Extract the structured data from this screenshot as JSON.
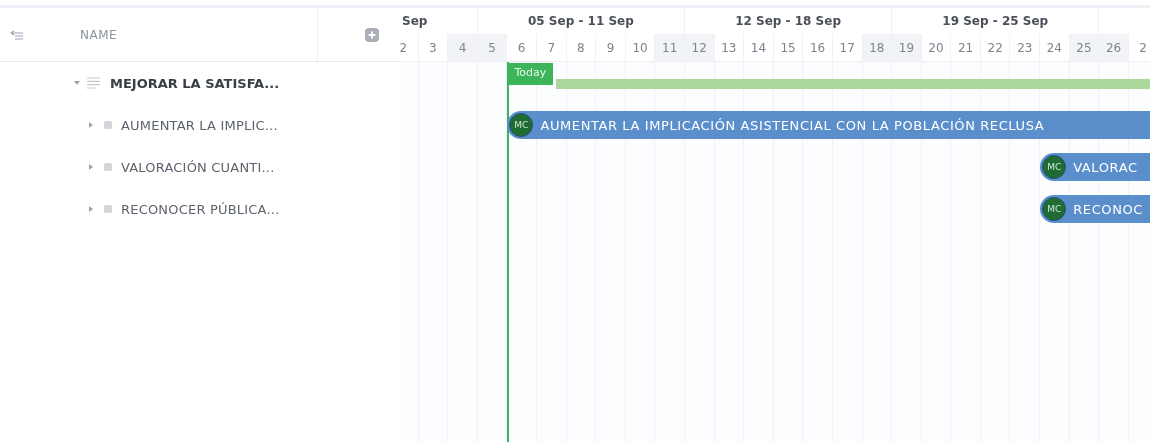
{
  "tree": {
    "header": {
      "name_label": "NAME"
    },
    "root": {
      "name": "MEJORAR LA SATISFA...",
      "expanded": true,
      "children": [
        {
          "name": "AUMENTAR LA IMPLIC...",
          "expanded": false
        },
        {
          "name": "VALORACIÓN CUANTI...",
          "expanded": false
        },
        {
          "name": "RECONOCER PÚBLICA...",
          "expanded": false
        }
      ]
    }
  },
  "timeline": {
    "weeks": [
      {
        "label": "Sep"
      },
      {
        "label": "05 Sep - 11 Sep"
      },
      {
        "label": "12 Sep - 18 Sep"
      },
      {
        "label": "19 Sep - 25 Sep"
      }
    ],
    "days": [
      {
        "label": "2",
        "weekend": false,
        "today": false
      },
      {
        "label": "3",
        "weekend": false,
        "today": false
      },
      {
        "label": "4",
        "weekend": true,
        "today": false
      },
      {
        "label": "5",
        "weekend": true,
        "today": false
      },
      {
        "label": "6",
        "weekend": false,
        "today": true
      },
      {
        "label": "7",
        "weekend": false,
        "today": false
      },
      {
        "label": "8",
        "weekend": false,
        "today": false
      },
      {
        "label": "9",
        "weekend": false,
        "today": false
      },
      {
        "label": "10",
        "weekend": false,
        "today": false
      },
      {
        "label": "11",
        "weekend": true,
        "today": false
      },
      {
        "label": "12",
        "weekend": true,
        "today": false
      },
      {
        "label": "13",
        "weekend": false,
        "today": false
      },
      {
        "label": "14",
        "weekend": false,
        "today": false
      },
      {
        "label": "15",
        "weekend": false,
        "today": false
      },
      {
        "label": "16",
        "weekend": false,
        "today": false
      },
      {
        "label": "17",
        "weekend": false,
        "today": false
      },
      {
        "label": "18",
        "weekend": true,
        "today": false
      },
      {
        "label": "19",
        "weekend": true,
        "today": false
      },
      {
        "label": "20",
        "weekend": false,
        "today": false
      },
      {
        "label": "21",
        "weekend": false,
        "today": false
      },
      {
        "label": "22",
        "weekend": false,
        "today": false
      },
      {
        "label": "23",
        "weekend": false,
        "today": false
      },
      {
        "label": "24",
        "weekend": false,
        "today": false
      },
      {
        "label": "25",
        "weekend": true,
        "today": false
      },
      {
        "label": "26",
        "weekend": true,
        "today": false
      },
      {
        "label": "2",
        "weekend": false,
        "today": false
      }
    ],
    "today_label": "Today",
    "bars": [
      {
        "kind": "summary",
        "color": "#acd79b"
      },
      {
        "kind": "task",
        "text": "AUMENTAR LA IMPLICACIÓN ASISTENCIAL CON LA POBLACIÓN RECLUSA",
        "avatar": "MC",
        "color": "#5b8fcc"
      },
      {
        "kind": "task",
        "text": "VALORAC",
        "avatar": "MC",
        "color": "#5b8fcc"
      },
      {
        "kind": "task",
        "text": "RECONOC",
        "avatar": "MC",
        "color": "#5b8fcc"
      }
    ]
  }
}
